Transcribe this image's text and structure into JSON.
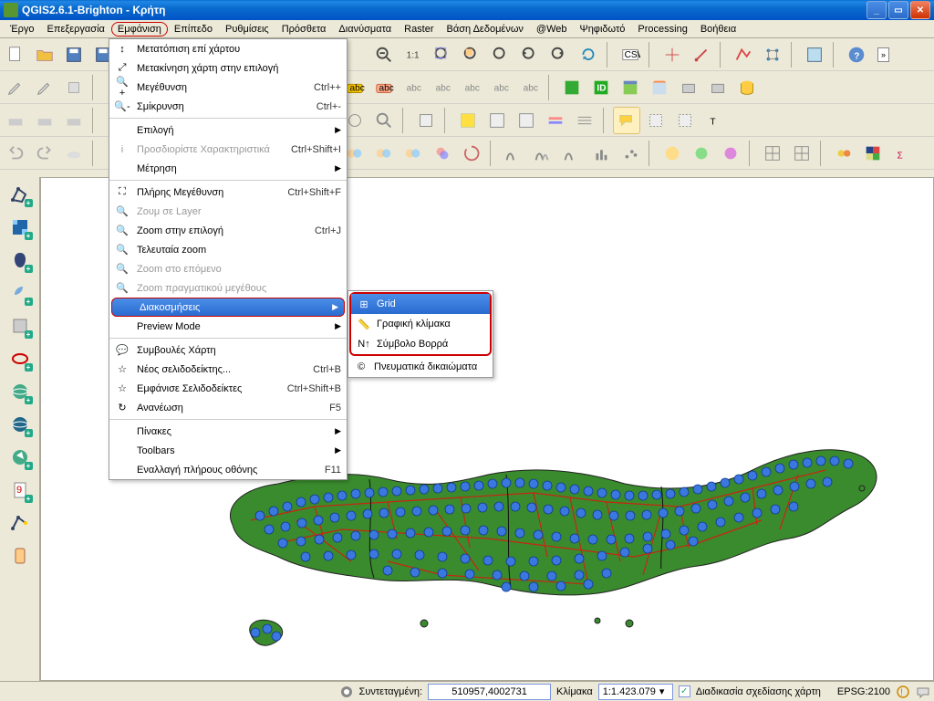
{
  "window": {
    "title": "QGIS2.6.1-Brighton - Κρήτη"
  },
  "menubar": [
    "Έργο",
    "Επεξεργασία",
    "Εμφάνιση",
    "Επίπεδο",
    "Ρυθμίσεις",
    "Πρόσθετα",
    "Διανύσματα",
    "Raster",
    "Βάση Δεδομένων",
    "@Web",
    "Ψηφιδωτό",
    "Processing",
    "Βοήθεια"
  ],
  "menu_highlight_index": 2,
  "view_menu": {
    "items": [
      {
        "icon": "↕",
        "label": "Μετατόπιση επί χάρτου",
        "shortcut": ""
      },
      {
        "icon": "⤢",
        "label": "Μετακίνηση χάρτη στην επιλογή",
        "shortcut": ""
      },
      {
        "icon": "🔍+",
        "label": "Μεγέθυνση",
        "shortcut": "Ctrl++"
      },
      {
        "icon": "🔍-",
        "label": "Σμίκρυνση",
        "shortcut": "Ctrl+-"
      },
      {
        "label": "Επιλογή",
        "submenu": true
      },
      {
        "icon": "i",
        "label": "Προσδιορίστε Χαρακτηριστικά",
        "shortcut": "Ctrl+Shift+I",
        "disabled": true
      },
      {
        "label": "Μέτρηση",
        "submenu": true
      },
      {
        "icon": "⛶",
        "label": "Πλήρης Μεγέθυνση",
        "shortcut": "Ctrl+Shift+F"
      },
      {
        "icon": "🔍",
        "label": "Ζουμ σε Layer",
        "disabled": true
      },
      {
        "icon": "🔍",
        "label": "Ζοοm στην επιλογή",
        "shortcut": "Ctrl+J"
      },
      {
        "icon": "🔍",
        "label": "Τελευταία zoom",
        "shortcut": ""
      },
      {
        "icon": "🔍",
        "label": "Zoom στο επόμενο",
        "disabled": true
      },
      {
        "icon": "🔍",
        "label": "Zoom πραγματικού μεγέθους",
        "disabled": true
      },
      {
        "label": "Διακοσμήσεις",
        "submenu": true,
        "highlight": true,
        "boxed": true
      },
      {
        "label": "Preview Mode",
        "submenu": true
      },
      {
        "icon": "💬",
        "label": "Συμβουλές Χάρτη",
        "shortcut": ""
      },
      {
        "icon": "☆",
        "label": "Νέος σελιδοδείκτης...",
        "shortcut": "Ctrl+B"
      },
      {
        "icon": "☆",
        "label": "Εμφάνισε Σελιδοδείκτες",
        "shortcut": "Ctrl+Shift+B"
      },
      {
        "icon": "↻",
        "label": "Ανανέωση",
        "shortcut": "F5"
      },
      {
        "label": "Πίνακες",
        "submenu": true
      },
      {
        "label": "Toolbars",
        "submenu": true
      },
      {
        "label": "Εναλλαγή πλήρους οθόνης",
        "shortcut": "F11"
      }
    ],
    "separators_after": [
      3,
      6,
      14,
      18
    ]
  },
  "decorations_submenu": {
    "items": [
      {
        "icon": "⊞",
        "label": "Grid",
        "highlight": true
      },
      {
        "icon": "📏",
        "label": "Γραφική κλίμακα"
      },
      {
        "icon": "N↑",
        "label": "Σύμβολο Βορρά"
      },
      {
        "icon": "©",
        "label": "Πνευματικά δικαιώματα"
      }
    ]
  },
  "statusbar": {
    "coord_label": "Συντεταγμένη:",
    "coord_value": "510957,4002731",
    "scale_label": "Κλίμακα",
    "scale_value": "1:1.423.079",
    "render_checked": true,
    "render_label": "Διαδικασία σχεδίασης χάρτη",
    "srs": "EPSG:2100"
  }
}
